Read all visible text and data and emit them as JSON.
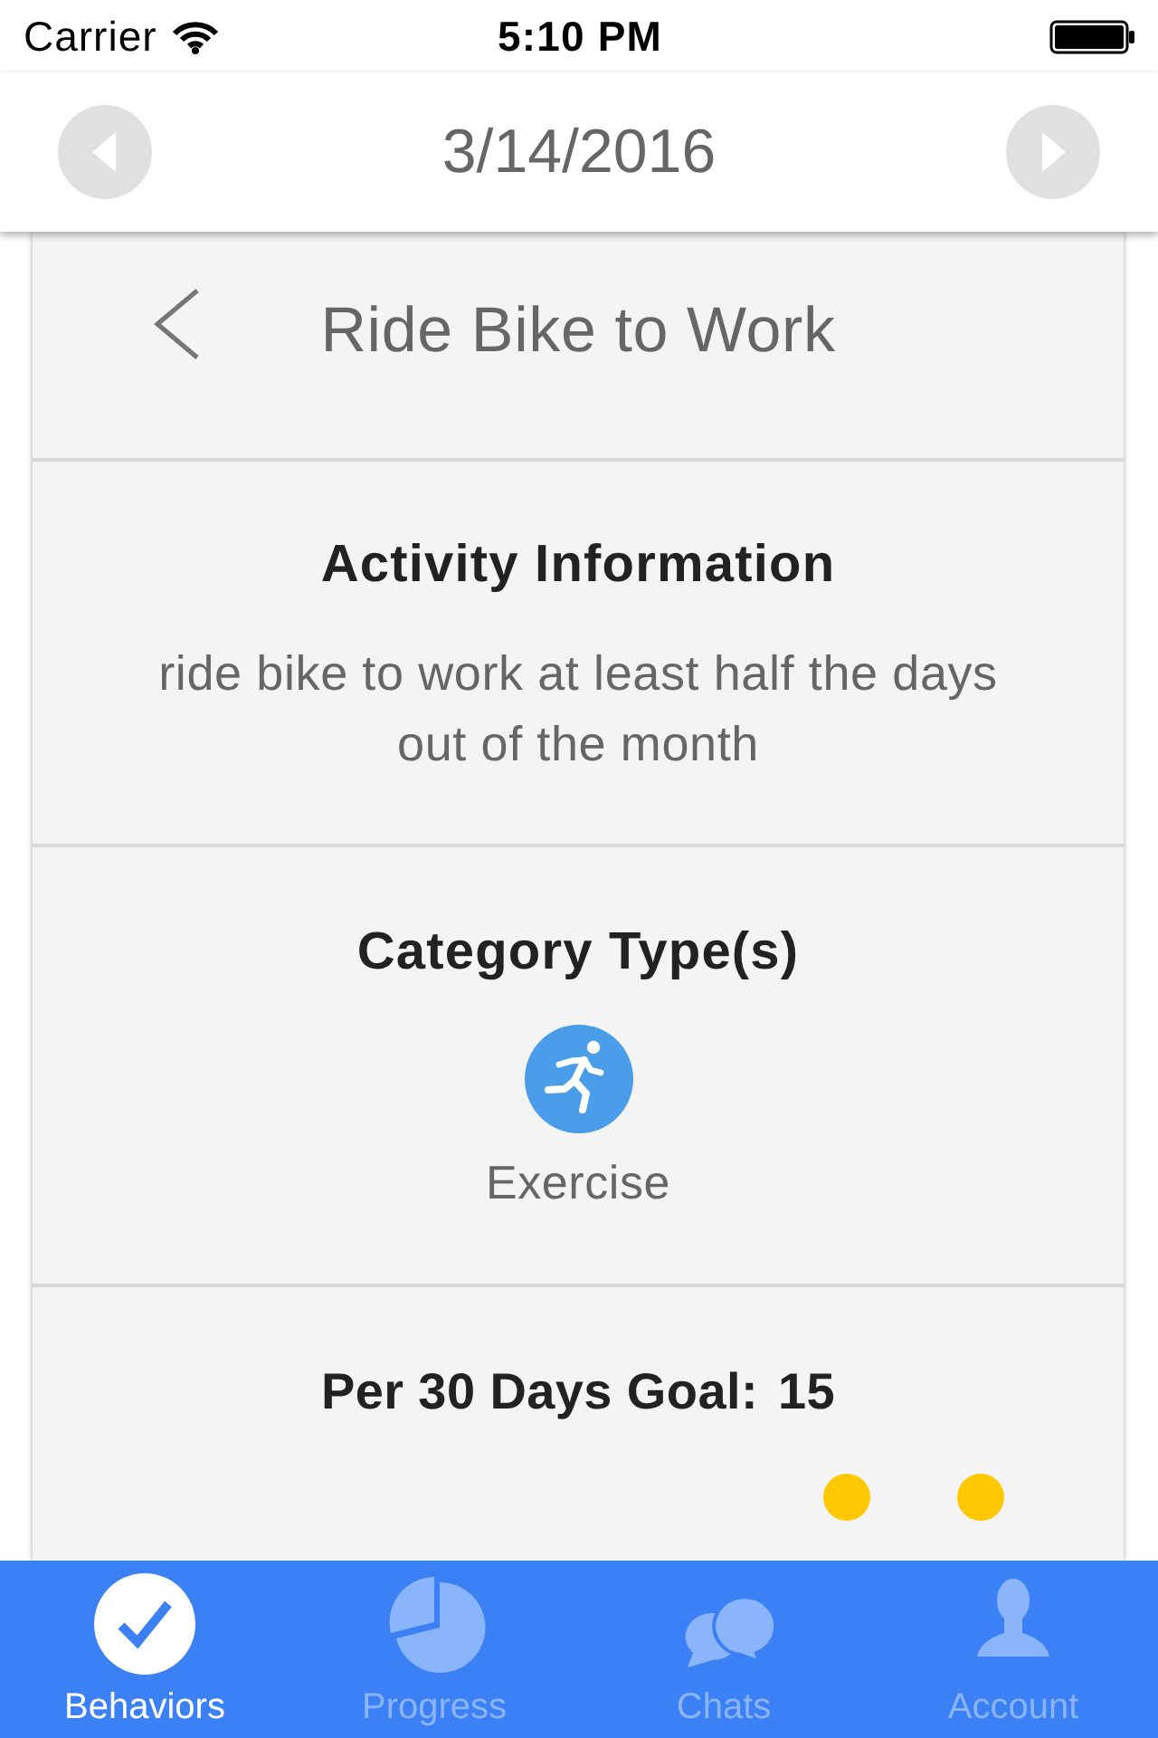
{
  "status_bar": {
    "carrier": "Carrier",
    "time": "5:10 PM"
  },
  "date_header": {
    "date": "3/14/2016"
  },
  "detail": {
    "title": "Ride Bike to Work",
    "activity_information": {
      "heading": "Activity Information",
      "description": "ride bike to work at least half the days out of the month"
    },
    "category_types": {
      "heading": "Category Type(s)",
      "items": [
        {
          "label": "Exercise"
        }
      ]
    },
    "goal": {
      "label": "Per 30 Days Goal:",
      "value": "15",
      "days": [
        {
          "filled": true
        },
        {
          "filled": true
        }
      ]
    }
  },
  "tab_bar": {
    "tabs": [
      {
        "label": "Behaviors",
        "selected": true
      },
      {
        "label": "Progress",
        "selected": false
      },
      {
        "label": "Chats",
        "selected": false
      },
      {
        "label": "Account",
        "selected": false
      }
    ]
  }
}
